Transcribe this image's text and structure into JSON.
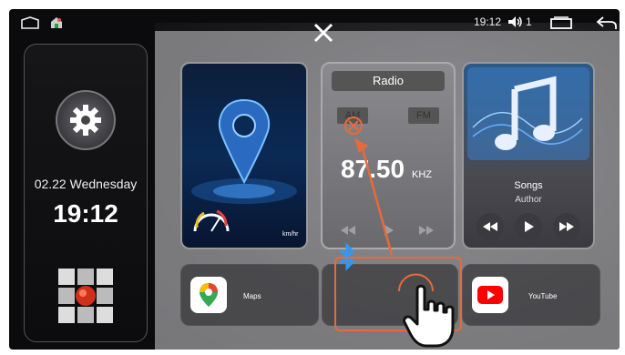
{
  "statusbar": {
    "time": "19:12",
    "volume_level": "1"
  },
  "left_panel": {
    "date": "02.22 Wednesday",
    "time": "19:12"
  },
  "radio": {
    "title": "Radio",
    "band_am": "AM",
    "band_fm": "FM",
    "frequency": "87.50",
    "unit": "KHZ"
  },
  "navigation": {
    "speed_unit": "km/hr"
  },
  "music": {
    "song": "Songs",
    "author": "Author"
  },
  "apps": [
    {
      "label": "Maps"
    },
    {
      "label": "YouTube"
    }
  ],
  "colors": {
    "accent": "#e86a3a",
    "bluetooth": "#2a9aff"
  }
}
